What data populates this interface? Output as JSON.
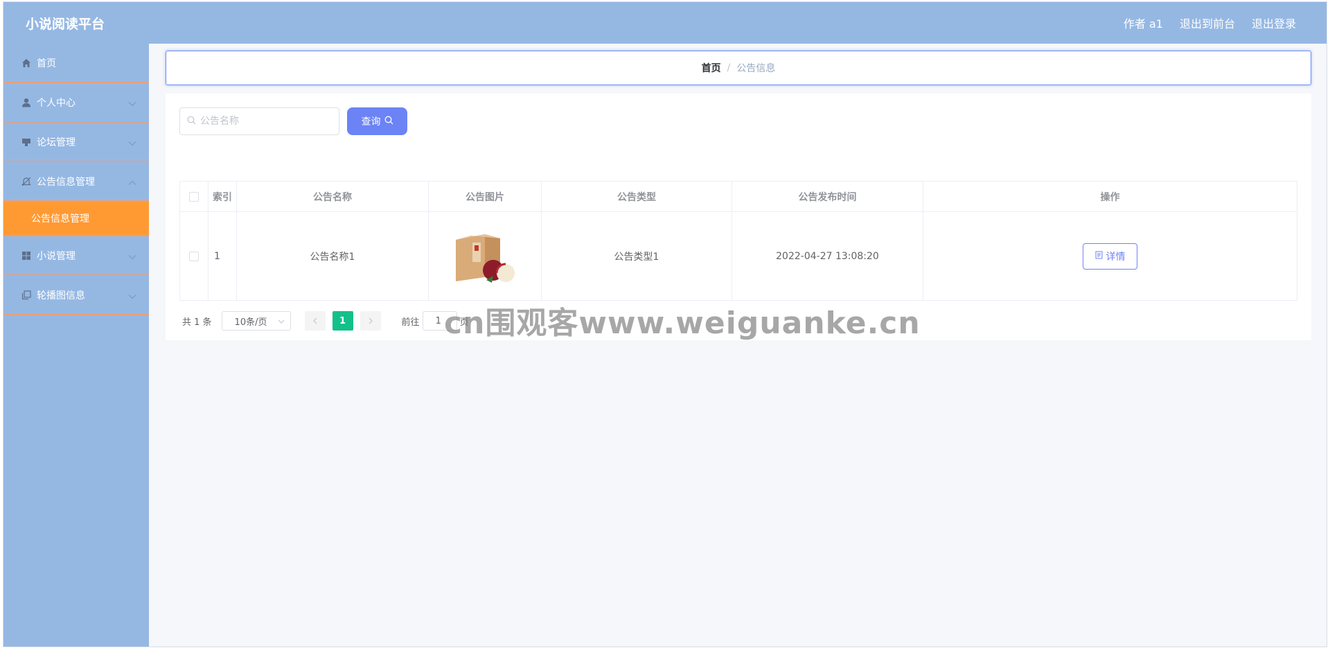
{
  "header": {
    "brand": "小说阅读平台",
    "links": [
      "作者 a1",
      "退出到前台",
      "退出登录"
    ]
  },
  "sidebar": {
    "items": [
      {
        "label": "首页",
        "icon": "home-icon",
        "has_chevron": false
      },
      {
        "label": "个人中心",
        "icon": "user-icon",
        "has_chevron": true
      },
      {
        "label": "论坛管理",
        "icon": "forum-icon",
        "has_chevron": true
      },
      {
        "label": "公告信息管理",
        "icon": "notice-icon",
        "has_chevron": true,
        "expanded": true
      },
      {
        "label": "小说管理",
        "icon": "grid-icon",
        "has_chevron": true
      },
      {
        "label": "轮播图信息",
        "icon": "carousel-icon",
        "has_chevron": true
      }
    ],
    "active_sub_item": "公告信息管理"
  },
  "breadcrumb": {
    "home": "首页",
    "separator": "/",
    "current": "公告信息"
  },
  "search": {
    "placeholder": "公告名称",
    "button_label": "查询"
  },
  "table": {
    "columns": [
      "索引",
      "公告名称",
      "公告图片",
      "公告类型",
      "公告发布时间",
      "操作"
    ],
    "rows": [
      {
        "index": "1",
        "name": "公告名称1",
        "image": "product-photo",
        "type": "公告类型1",
        "time": "2022-04-27 13:08:20",
        "action": "详情"
      }
    ]
  },
  "pager": {
    "total": "共 1 条",
    "page_size": "10条/页",
    "current_page": "1",
    "jump_label": "前往",
    "jump_value": "1",
    "jump_suffix": "页"
  },
  "watermark": "cn围观客www.weiguanke.cn",
  "colors": {
    "header_bg": "#95b8e3",
    "sidebar_bg": "#95b8e3",
    "active_sub_bg": "#ff9a33",
    "primary": "#6c83f5",
    "page_active": "#13c08a"
  }
}
